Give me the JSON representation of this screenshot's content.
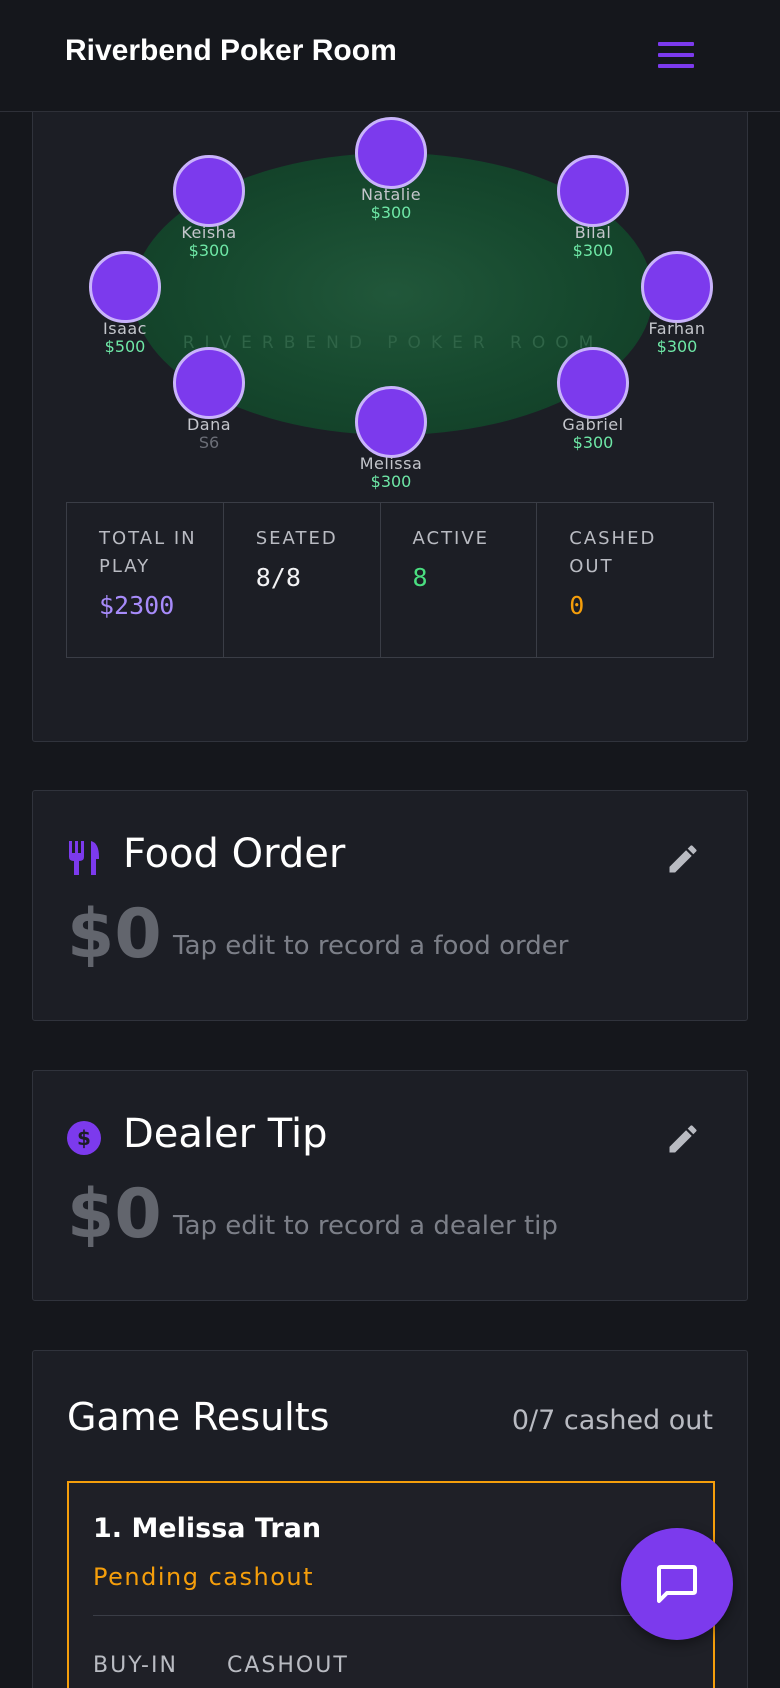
{
  "header": {
    "title": "Riverbend Poker Room"
  },
  "table": {
    "felt_text": "RIVERBEND POKER ROOM",
    "seats": [
      {
        "name": "Natalie",
        "amount": "$300"
      },
      {
        "name": "Keisha",
        "amount": "$300"
      },
      {
        "name": "Bilal",
        "amount": "$300"
      },
      {
        "name": "Isaac",
        "amount": "$500"
      },
      {
        "name": "Farhan",
        "amount": "$300"
      },
      {
        "name": "Dana",
        "amount": "S6"
      },
      {
        "name": "Gabriel",
        "amount": "$300"
      },
      {
        "name": "Melissa",
        "amount": "$300"
      }
    ],
    "stats": [
      {
        "label": "TOTAL IN PLAY",
        "value": "$2300"
      },
      {
        "label": "SEATED",
        "value": "8/8"
      },
      {
        "label": "ACTIVE",
        "value": "8"
      },
      {
        "label": "CASHED OUT",
        "value": "0"
      }
    ]
  },
  "food_order": {
    "title": "Food Order",
    "amount": "$0",
    "hint": "Tap edit to record a food order",
    "icon": "utensils-icon"
  },
  "dealer_tip": {
    "title": "Dealer Tip",
    "amount": "$0",
    "hint": "Tap edit to record a dealer tip",
    "icon": "dollar-circle-icon"
  },
  "game_results": {
    "title": "Game Results",
    "count": "0/7 cashed out",
    "entries": [
      {
        "name": "1. Melissa Tran",
        "status": "Pending cashout",
        "col_buyin": "BUY-IN",
        "col_cashout": "CASHOUT"
      }
    ]
  },
  "colors": {
    "accent": "#7c3aed",
    "positive": "#4ade80",
    "pending": "#f59e0b",
    "money": "#6ee7a6"
  }
}
